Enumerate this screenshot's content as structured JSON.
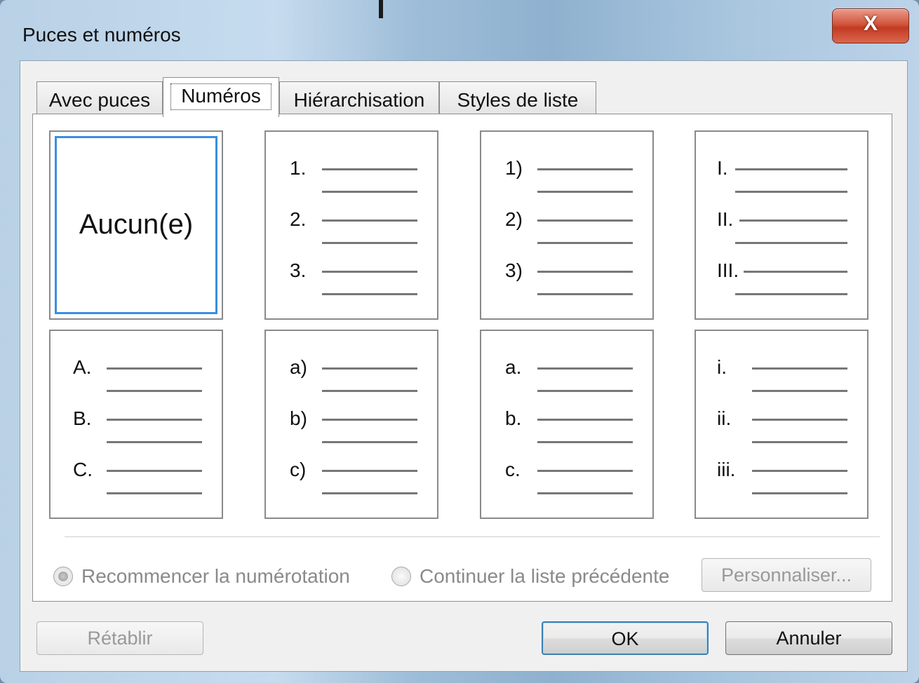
{
  "window": {
    "title": "Puces et numéros",
    "close_label": "X"
  },
  "tabs": [
    {
      "label": "Avec puces",
      "active": false
    },
    {
      "label": "Numéros",
      "active": true
    },
    {
      "label": "Hiérarchisation",
      "active": false
    },
    {
      "label": "Styles de liste",
      "active": false
    }
  ],
  "styles": {
    "none_label": "Aucun(e)",
    "lists": [
      [
        "1.",
        "2.",
        "3."
      ],
      [
        "1)",
        "2)",
        "3)"
      ],
      [
        "I.",
        "II.",
        "III."
      ],
      [
        "A.",
        "B.",
        "C."
      ],
      [
        "a)",
        "b)",
        "c)"
      ],
      [
        "a.",
        "b.",
        "c."
      ],
      [
        "i.",
        "ii.",
        "iii."
      ]
    ]
  },
  "options": {
    "restart_label": "Recommencer la numérotation",
    "continue_label": "Continuer la liste précédente",
    "customize_label": "Personnaliser..."
  },
  "buttons": {
    "reset_label": "Rétablir",
    "ok_label": "OK",
    "cancel_label": "Annuler"
  },
  "colors": {
    "selection_border": "#3a8ee0",
    "close_button": "#c23a22"
  }
}
